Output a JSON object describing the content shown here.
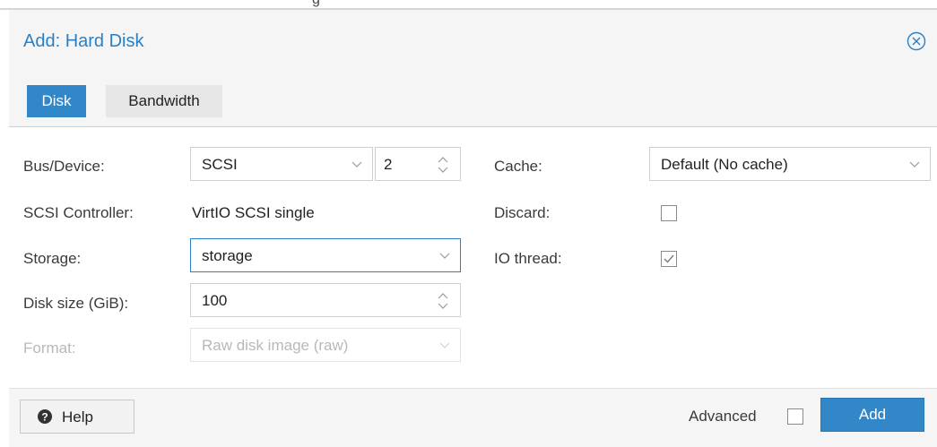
{
  "top_fragment": "g",
  "dialog": {
    "title": "Add: Hard Disk",
    "close_icon": "close-circle-icon",
    "accent_color": "#3287c9"
  },
  "tabs": [
    {
      "label": "Disk",
      "active": true
    },
    {
      "label": "Bandwidth",
      "active": false
    }
  ],
  "form": {
    "bus_device": {
      "label": "Bus/Device:",
      "bus_value": "SCSI",
      "device_value": "2"
    },
    "scsi_controller": {
      "label": "SCSI Controller:",
      "value": "VirtIO SCSI single"
    },
    "storage": {
      "label": "Storage:",
      "value": "storage"
    },
    "disk_size": {
      "label": "Disk size (GiB):",
      "value": "100"
    },
    "format": {
      "label": "Format:",
      "value": "Raw disk image (raw)",
      "disabled": true
    },
    "cache": {
      "label": "Cache:",
      "value": "Default (No cache)"
    },
    "discard": {
      "label": "Discard:",
      "checked": false
    },
    "io_thread": {
      "label": "IO thread:",
      "checked": true
    }
  },
  "footer": {
    "help_label": "Help",
    "help_icon": "question-circle-icon",
    "advanced_label": "Advanced",
    "advanced_checked": false,
    "add_label": "Add"
  }
}
